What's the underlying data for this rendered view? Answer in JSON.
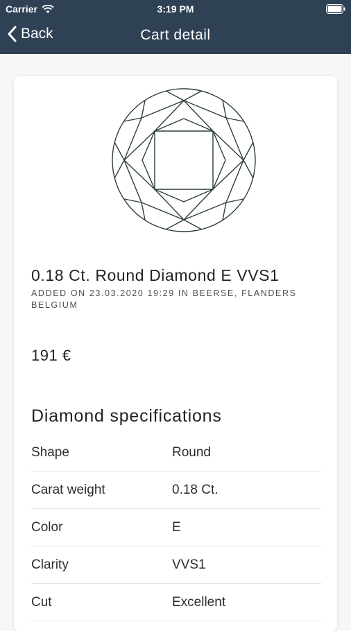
{
  "status_bar": {
    "carrier": "Carrier",
    "time": "3:19 PM"
  },
  "nav": {
    "back_label": "Back",
    "title": "Cart detail"
  },
  "item": {
    "title": "0.18 Ct. Round Diamond E VVS1",
    "meta": "ADDED ON 23.03.2020 19:29 IN BEERSE, FLANDERS BELGIUM",
    "price": "191 €"
  },
  "specifications": {
    "heading": "Diamond specifications",
    "rows": [
      {
        "label": "Shape",
        "value": "Round"
      },
      {
        "label": "Carat weight",
        "value": "0.18 Ct."
      },
      {
        "label": "Color",
        "value": "E"
      },
      {
        "label": "Clarity",
        "value": "VVS1"
      },
      {
        "label": "Cut",
        "value": "Excellent"
      }
    ]
  },
  "colors": {
    "header_bg": "#2f4155",
    "diamond_stroke": "#2c3e3a"
  }
}
